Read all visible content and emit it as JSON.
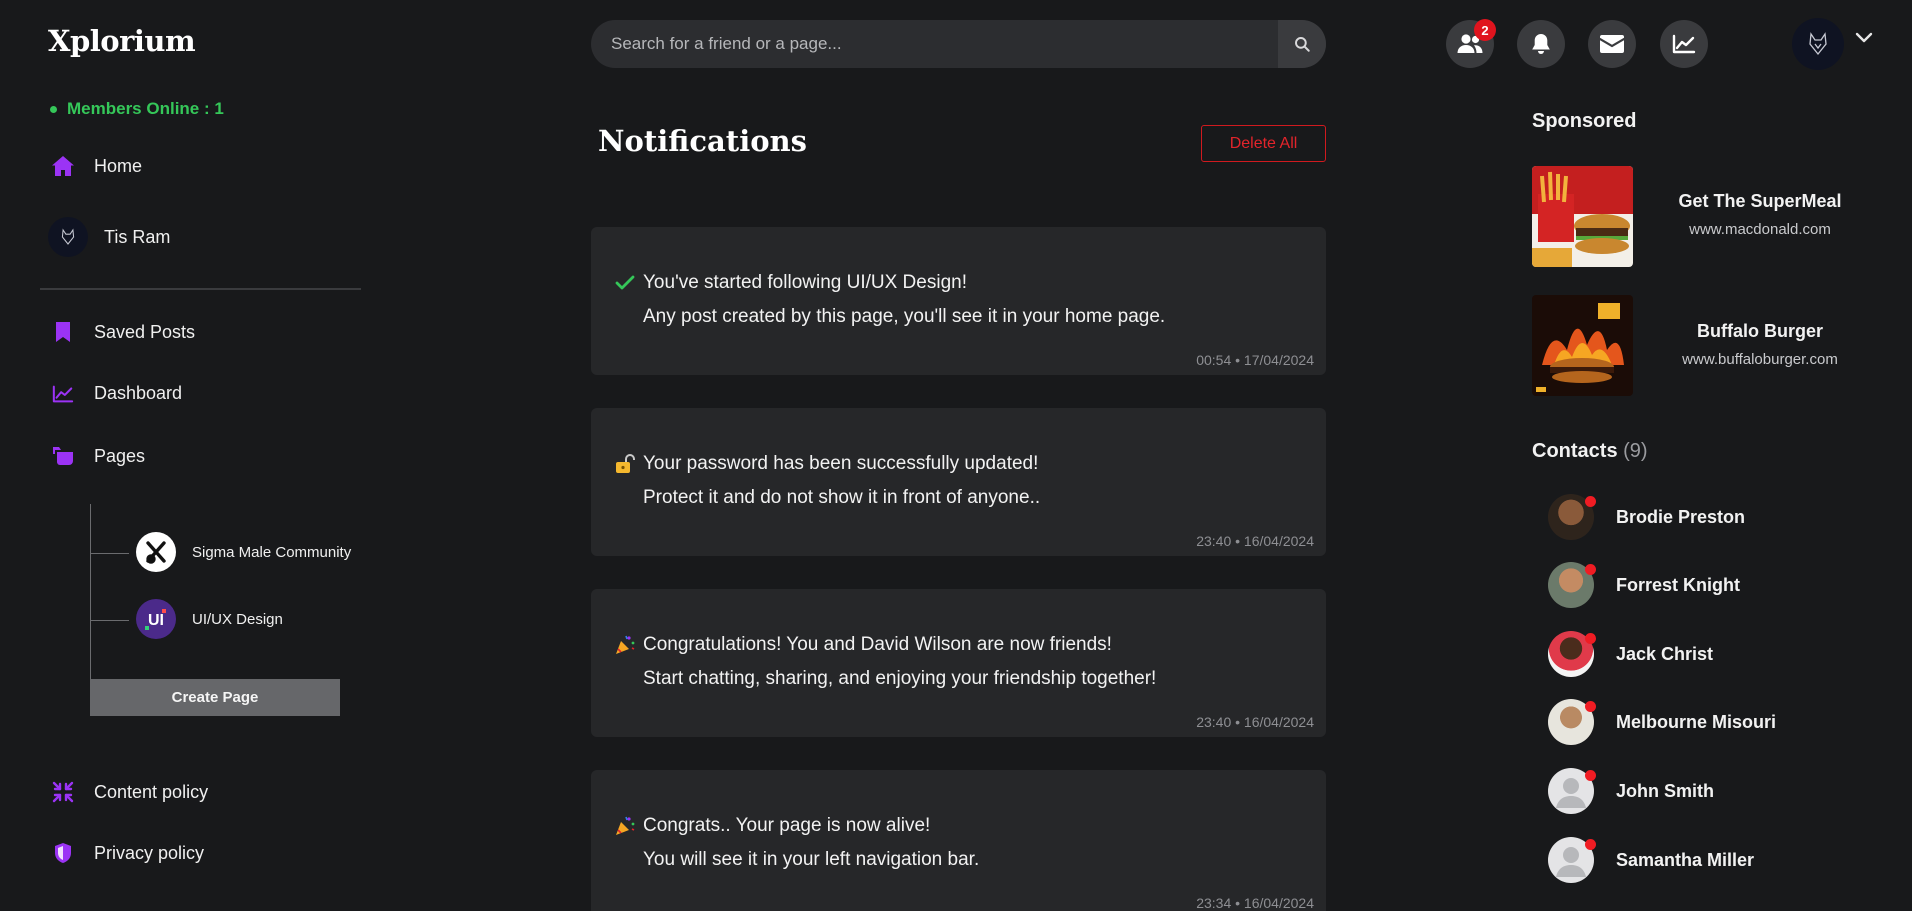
{
  "header": {
    "logo": "Xplorium",
    "search": {
      "placeholder": "Search for a friend or a page..."
    },
    "friend_requests_badge": "2"
  },
  "sidebar": {
    "members_online": "Members Online : 1",
    "home": "Home",
    "user_name": "Tis Ram",
    "saved_posts": "Saved Posts",
    "dashboard": "Dashboard",
    "pages": "Pages",
    "page_list": [
      {
        "name": "Sigma Male Community"
      },
      {
        "name": "UI/UX Design"
      }
    ],
    "create_page": "Create Page",
    "content_policy": "Content policy",
    "privacy_policy": "Privacy policy"
  },
  "main": {
    "title": "Notifications",
    "delete_all": "Delete All",
    "notifications": [
      {
        "icon": "checkmark-icon",
        "line1": "You've started following UI/UX Design!",
        "line2": "Any post created by this page, you'll see it in your home page.",
        "time": "00:54 • 17/04/2024"
      },
      {
        "icon": "lock-icon",
        "line1": "Your password has been successfully updated!",
        "line2": "Protect it and do not show it in front of anyone..",
        "time": "23:40 • 16/04/2024"
      },
      {
        "icon": "party-popper-icon",
        "line1": "Congratulations! You and David Wilson are now friends!",
        "line2": "Start chatting, sharing, and enjoying your friendship together!",
        "time": "23:40 • 16/04/2024"
      },
      {
        "icon": "party-popper-icon",
        "line1": "Congrats.. Your page is now alive!",
        "line2": "You will see it in your left navigation bar.",
        "time": "23:34 • 16/04/2024"
      }
    ]
  },
  "right": {
    "sponsored_title": "Sponsored",
    "ads": [
      {
        "title": "Get The SuperMeal",
        "url": "www.macdonald.com"
      },
      {
        "title": "Buffalo Burger",
        "url": "www.buffaloburger.com"
      }
    ],
    "contacts_title": "Contacts",
    "contacts_count": "(9)",
    "contacts": [
      {
        "name": "Brodie Preston"
      },
      {
        "name": "Forrest Knight"
      },
      {
        "name": "Jack Christ"
      },
      {
        "name": "Melbourne Misouri"
      },
      {
        "name": "John Smith"
      },
      {
        "name": "Samantha Miller"
      }
    ]
  },
  "colors": {
    "background": "#18191b",
    "card": "#262729",
    "accent_purple": "#9b33f5",
    "online_green": "#35c759",
    "danger_red": "#e2242b"
  }
}
